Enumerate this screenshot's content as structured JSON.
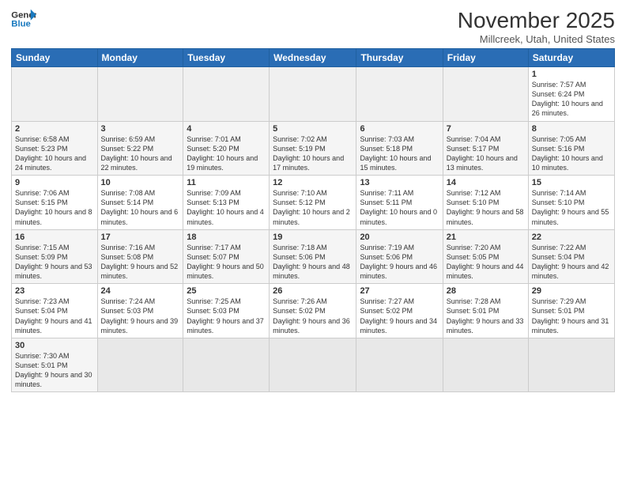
{
  "logo": {
    "text_general": "General",
    "text_blue": "Blue"
  },
  "header": {
    "month": "November 2025",
    "location": "Millcreek, Utah, United States"
  },
  "weekdays": [
    "Sunday",
    "Monday",
    "Tuesday",
    "Wednesday",
    "Thursday",
    "Friday",
    "Saturday"
  ],
  "weeks": [
    [
      {
        "day": "",
        "info": "",
        "empty": true
      },
      {
        "day": "",
        "info": "",
        "empty": true
      },
      {
        "day": "",
        "info": "",
        "empty": true
      },
      {
        "day": "",
        "info": "",
        "empty": true
      },
      {
        "day": "",
        "info": "",
        "empty": true
      },
      {
        "day": "",
        "info": "",
        "empty": true
      },
      {
        "day": "1",
        "info": "Sunrise: 7:57 AM\nSunset: 6:24 PM\nDaylight: 10 hours\nand 26 minutes."
      }
    ],
    [
      {
        "day": "2",
        "info": "Sunrise: 6:58 AM\nSunset: 5:23 PM\nDaylight: 10 hours\nand 24 minutes."
      },
      {
        "day": "3",
        "info": "Sunrise: 6:59 AM\nSunset: 5:22 PM\nDaylight: 10 hours\nand 22 minutes."
      },
      {
        "day": "4",
        "info": "Sunrise: 7:01 AM\nSunset: 5:20 PM\nDaylight: 10 hours\nand 19 minutes."
      },
      {
        "day": "5",
        "info": "Sunrise: 7:02 AM\nSunset: 5:19 PM\nDaylight: 10 hours\nand 17 minutes."
      },
      {
        "day": "6",
        "info": "Sunrise: 7:03 AM\nSunset: 5:18 PM\nDaylight: 10 hours\nand 15 minutes."
      },
      {
        "day": "7",
        "info": "Sunrise: 7:04 AM\nSunset: 5:17 PM\nDaylight: 10 hours\nand 13 minutes."
      },
      {
        "day": "8",
        "info": "Sunrise: 7:05 AM\nSunset: 5:16 PM\nDaylight: 10 hours\nand 10 minutes."
      }
    ],
    [
      {
        "day": "9",
        "info": "Sunrise: 7:06 AM\nSunset: 5:15 PM\nDaylight: 10 hours\nand 8 minutes."
      },
      {
        "day": "10",
        "info": "Sunrise: 7:08 AM\nSunset: 5:14 PM\nDaylight: 10 hours\nand 6 minutes."
      },
      {
        "day": "11",
        "info": "Sunrise: 7:09 AM\nSunset: 5:13 PM\nDaylight: 10 hours\nand 4 minutes."
      },
      {
        "day": "12",
        "info": "Sunrise: 7:10 AM\nSunset: 5:12 PM\nDaylight: 10 hours\nand 2 minutes."
      },
      {
        "day": "13",
        "info": "Sunrise: 7:11 AM\nSunset: 5:11 PM\nDaylight: 10 hours\nand 0 minutes."
      },
      {
        "day": "14",
        "info": "Sunrise: 7:12 AM\nSunset: 5:10 PM\nDaylight: 9 hours\nand 58 minutes."
      },
      {
        "day": "15",
        "info": "Sunrise: 7:14 AM\nSunset: 5:10 PM\nDaylight: 9 hours\nand 55 minutes."
      }
    ],
    [
      {
        "day": "16",
        "info": "Sunrise: 7:15 AM\nSunset: 5:09 PM\nDaylight: 9 hours\nand 53 minutes."
      },
      {
        "day": "17",
        "info": "Sunrise: 7:16 AM\nSunset: 5:08 PM\nDaylight: 9 hours\nand 52 minutes."
      },
      {
        "day": "18",
        "info": "Sunrise: 7:17 AM\nSunset: 5:07 PM\nDaylight: 9 hours\nand 50 minutes."
      },
      {
        "day": "19",
        "info": "Sunrise: 7:18 AM\nSunset: 5:06 PM\nDaylight: 9 hours\nand 48 minutes."
      },
      {
        "day": "20",
        "info": "Sunrise: 7:19 AM\nSunset: 5:06 PM\nDaylight: 9 hours\nand 46 minutes."
      },
      {
        "day": "21",
        "info": "Sunrise: 7:20 AM\nSunset: 5:05 PM\nDaylight: 9 hours\nand 44 minutes."
      },
      {
        "day": "22",
        "info": "Sunrise: 7:22 AM\nSunset: 5:04 PM\nDaylight: 9 hours\nand 42 minutes."
      }
    ],
    [
      {
        "day": "23",
        "info": "Sunrise: 7:23 AM\nSunset: 5:04 PM\nDaylight: 9 hours\nand 41 minutes."
      },
      {
        "day": "24",
        "info": "Sunrise: 7:24 AM\nSunset: 5:03 PM\nDaylight: 9 hours\nand 39 minutes."
      },
      {
        "day": "25",
        "info": "Sunrise: 7:25 AM\nSunset: 5:03 PM\nDaylight: 9 hours\nand 37 minutes."
      },
      {
        "day": "26",
        "info": "Sunrise: 7:26 AM\nSunset: 5:02 PM\nDaylight: 9 hours\nand 36 minutes."
      },
      {
        "day": "27",
        "info": "Sunrise: 7:27 AM\nSunset: 5:02 PM\nDaylight: 9 hours\nand 34 minutes."
      },
      {
        "day": "28",
        "info": "Sunrise: 7:28 AM\nSunset: 5:01 PM\nDaylight: 9 hours\nand 33 minutes."
      },
      {
        "day": "29",
        "info": "Sunrise: 7:29 AM\nSunset: 5:01 PM\nDaylight: 9 hours\nand 31 minutes."
      }
    ],
    [
      {
        "day": "30",
        "info": "Sunrise: 7:30 AM\nSunset: 5:01 PM\nDaylight: 9 hours\nand 30 minutes."
      },
      {
        "day": "",
        "info": "",
        "empty": true
      },
      {
        "day": "",
        "info": "",
        "empty": true
      },
      {
        "day": "",
        "info": "",
        "empty": true
      },
      {
        "day": "",
        "info": "",
        "empty": true
      },
      {
        "day": "",
        "info": "",
        "empty": true
      },
      {
        "day": "",
        "info": "",
        "empty": true
      }
    ]
  ]
}
